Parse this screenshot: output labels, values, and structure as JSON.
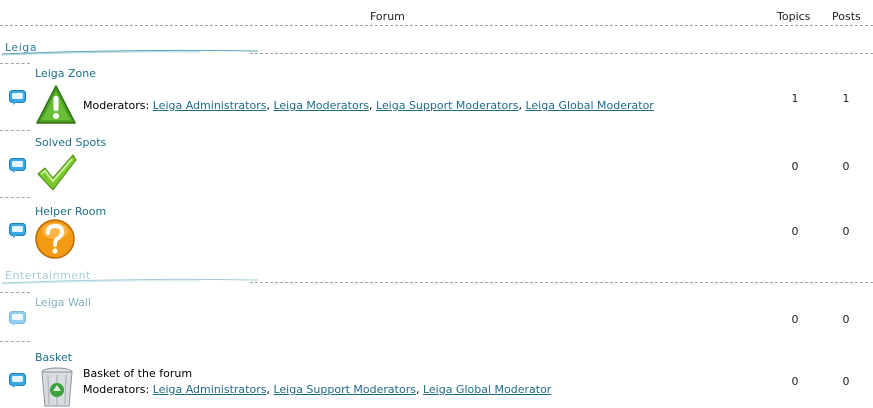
{
  "header": {
    "forum_label": "Forum",
    "topics_label": "Topics",
    "posts_label": "Posts"
  },
  "colors": {
    "link": "#1f6b86",
    "forum_title": "#1b6f86",
    "category_title": "#2c7f99",
    "separator": "#9aa6ad"
  },
  "categories": [
    {
      "title": "Leiga",
      "forums": [
        {
          "name": "Leiga Zone",
          "icon": "warning-exclamation-icon",
          "moderators_label": "Moderators:",
          "moderators": [
            "Leiga Administrators",
            "Leiga Moderators",
            "Leiga Support Moderators",
            "Leiga Global Moderator"
          ],
          "topics": "1",
          "posts": "1"
        },
        {
          "name": "Solved Spots",
          "icon": "checkmark-icon",
          "topics": "0",
          "posts": "0"
        },
        {
          "name": "Helper Room",
          "icon": "question-mark-icon",
          "topics": "0",
          "posts": "0"
        }
      ]
    },
    {
      "title": "Entertainment",
      "forums": [
        {
          "name": "Leiga Wall",
          "icon": "",
          "topics": "0",
          "posts": "0"
        },
        {
          "name": "Basket",
          "icon": "recycle-bin-icon",
          "description": "Basket of the forum",
          "moderators_label": "Moderators:",
          "moderators": [
            "Leiga Administrators",
            "Leiga Support Moderators",
            "Leiga Global Moderator"
          ],
          "topics": "0",
          "posts": "0"
        }
      ]
    }
  ]
}
